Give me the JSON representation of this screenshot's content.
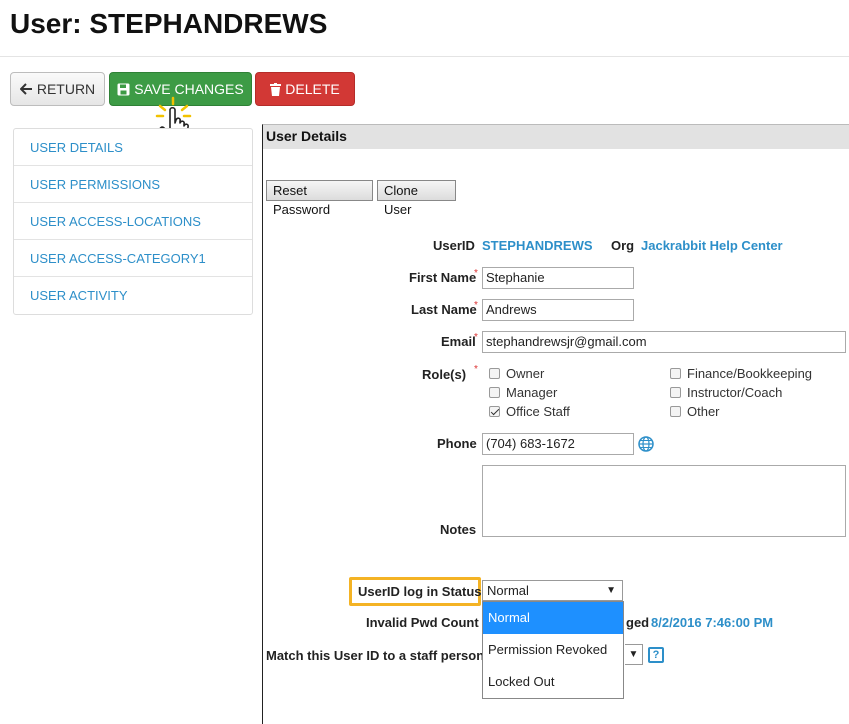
{
  "page": {
    "title": "User: STEPHANDREWS"
  },
  "toolbar": {
    "return_label": "RETURN",
    "save_label": "SAVE CHANGES",
    "delete_label": "DELETE"
  },
  "sidebar": {
    "items": [
      {
        "label": "USER DETAILS"
      },
      {
        "label": "USER PERMISSIONS"
      },
      {
        "label": "USER ACCESS-LOCATIONS"
      },
      {
        "label": "USER ACCESS-CATEGORY1"
      },
      {
        "label": "USER ACTIVITY"
      }
    ]
  },
  "panel": {
    "title": "User Details",
    "reset_password_label": "Reset Password",
    "clone_user_label": "Clone User"
  },
  "form": {
    "userid_label": "UserID",
    "userid_value": "STEPHANDREWS",
    "org_label": "Org",
    "org_value": "Jackrabbit Help Center",
    "first_name_label": "First Name",
    "first_name_value": "Stephanie",
    "last_name_label": "Last Name",
    "last_name_value": "Andrews",
    "email_label": "Email",
    "email_value": "stephandrewsjr@gmail.com",
    "roles_label": "Role(s)",
    "required_mark": "*",
    "roles": [
      {
        "label": "Owner",
        "checked": false
      },
      {
        "label": "Manager",
        "checked": false
      },
      {
        "label": "Office Staff",
        "checked": true
      },
      {
        "label": "Finance/Bookkeeping",
        "checked": false
      },
      {
        "label": "Instructor/Coach",
        "checked": false
      },
      {
        "label": "Other",
        "checked": false
      }
    ],
    "phone_label": "Phone",
    "phone_value": "(704) 683-1672",
    "notes_label": "Notes",
    "notes_value": "",
    "login_status_label": "UserID log in Status",
    "login_status_value": "Normal",
    "login_status_options": [
      "Normal",
      "Permission Revoked",
      "Locked Out"
    ],
    "invalid_pwd_label": "Invalid Pwd Count",
    "pwd_changed_label_partial": "ged",
    "pwd_changed_value": "8/2/2016 7:46:00 PM",
    "match_staff_label": "Match this User ID to a staff person",
    "help_glyph": "?"
  },
  "colors": {
    "link": "#2d8fc9",
    "save": "#3d9b45",
    "delete": "#d23835",
    "highlight": "#f4b324",
    "selected_option": "#1e90ff"
  },
  "icons": {
    "return": "arrow-left-icon",
    "save": "floppy-disk-icon",
    "delete": "trash-icon",
    "phone": "globe-icon",
    "cursor": "hand-pointer-icon",
    "help": "help-icon"
  }
}
